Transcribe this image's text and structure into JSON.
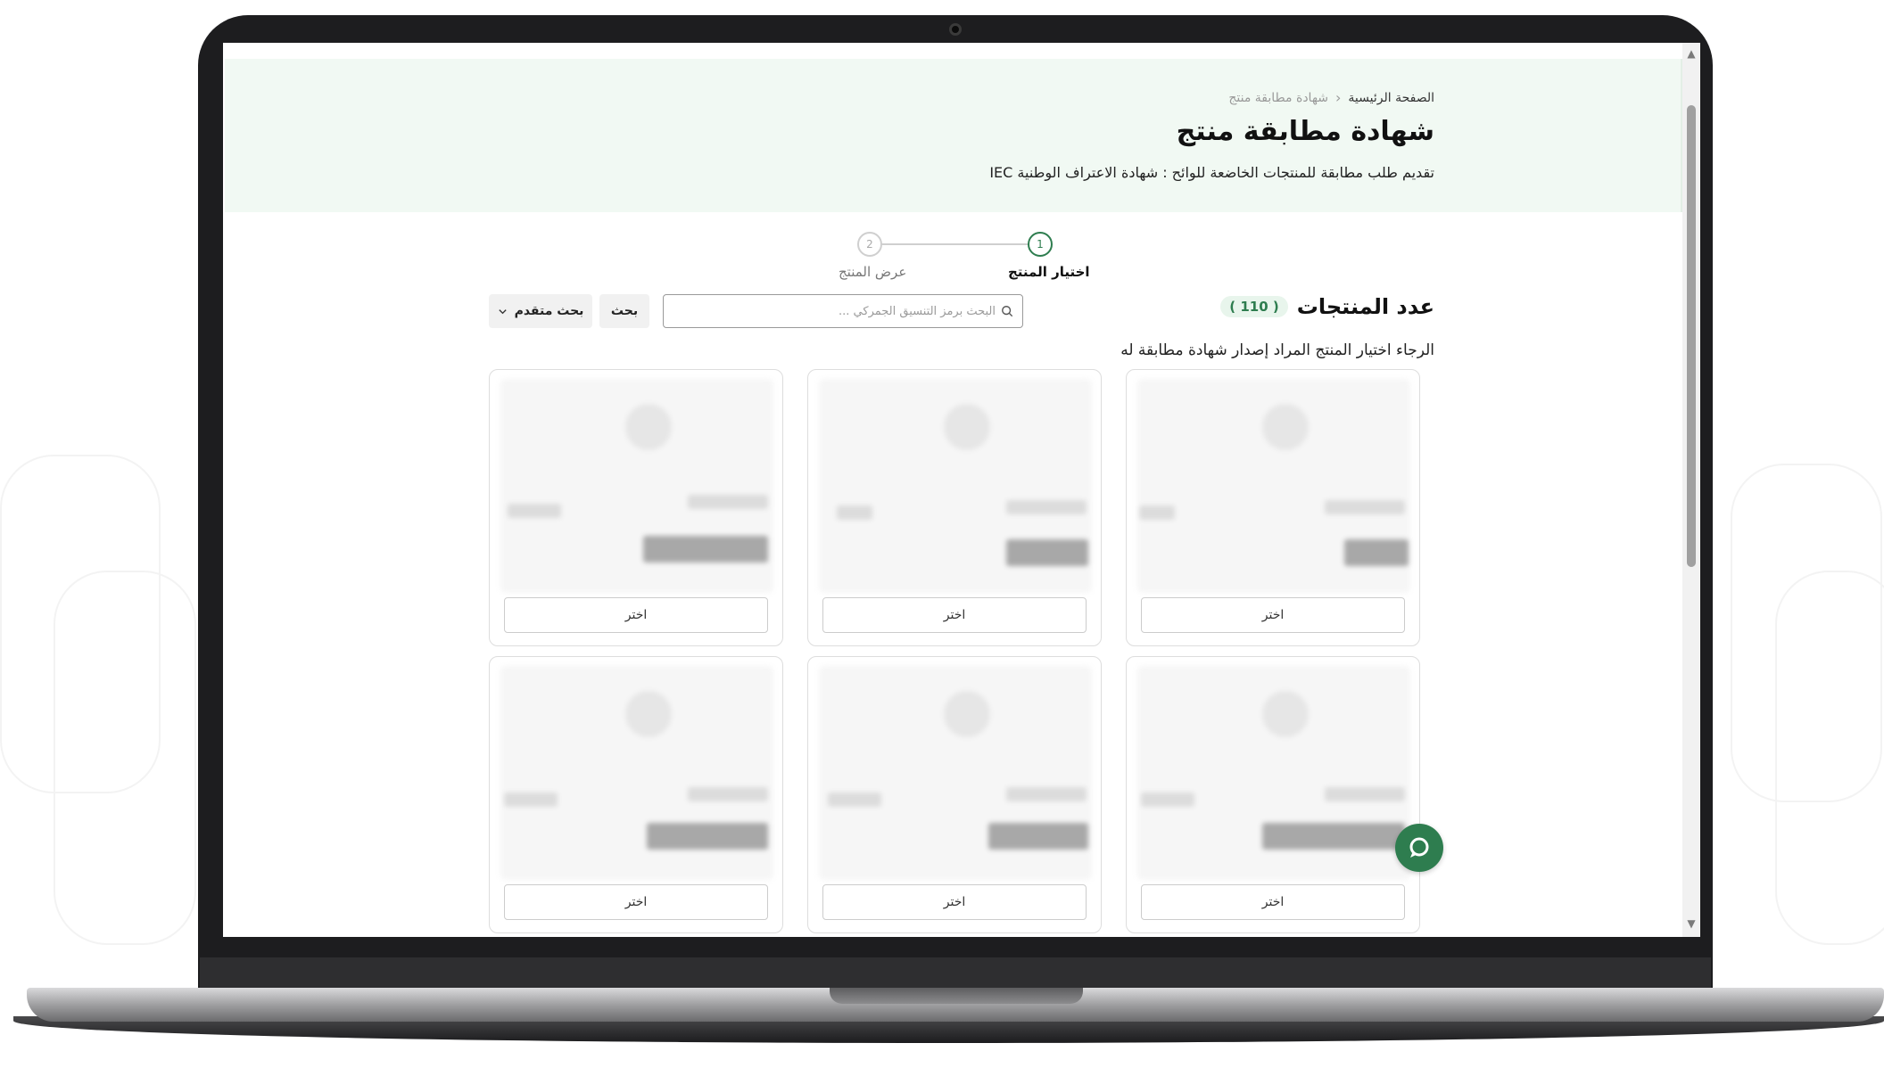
{
  "breadcrumb": {
    "home": "الصفحة الرئيسية",
    "current": "شهادة مطابقة منتج"
  },
  "page": {
    "title": "شهادة مطابقة منتج",
    "subtitle": "تقديم طلب مطابقة للمنتجات الخاضعة للوائح : شهادة الاعتراف الوطنية IEC"
  },
  "stepper": {
    "steps": [
      {
        "number": "1",
        "label": "اختيار المنتج",
        "state": "active"
      },
      {
        "number": "2",
        "label": "عرض المنتج",
        "state": "inactive"
      }
    ]
  },
  "products": {
    "count_label": "عدد المنتجات",
    "count": "( 110 )",
    "hint": "الرجاء اختيار المنتج المراد إصدار شهادة مطابقة له"
  },
  "search": {
    "placeholder": "البحث برمز التنسيق الجمركي ...",
    "button_label": "بحث",
    "advanced_label": "بحث متقدم"
  },
  "cards": [
    {
      "select_label": "اختر"
    },
    {
      "select_label": "اختر"
    },
    {
      "select_label": "اختر"
    },
    {
      "select_label": "اختر"
    },
    {
      "select_label": "اختر"
    },
    {
      "select_label": "اختر"
    }
  ],
  "colors": {
    "accent": "#2e7d4f",
    "hero_bg": "#f1f9f3"
  },
  "icons": {
    "chat": "chat-bubble-icon",
    "search": "search-icon",
    "chevron": "chevron-down-icon"
  }
}
